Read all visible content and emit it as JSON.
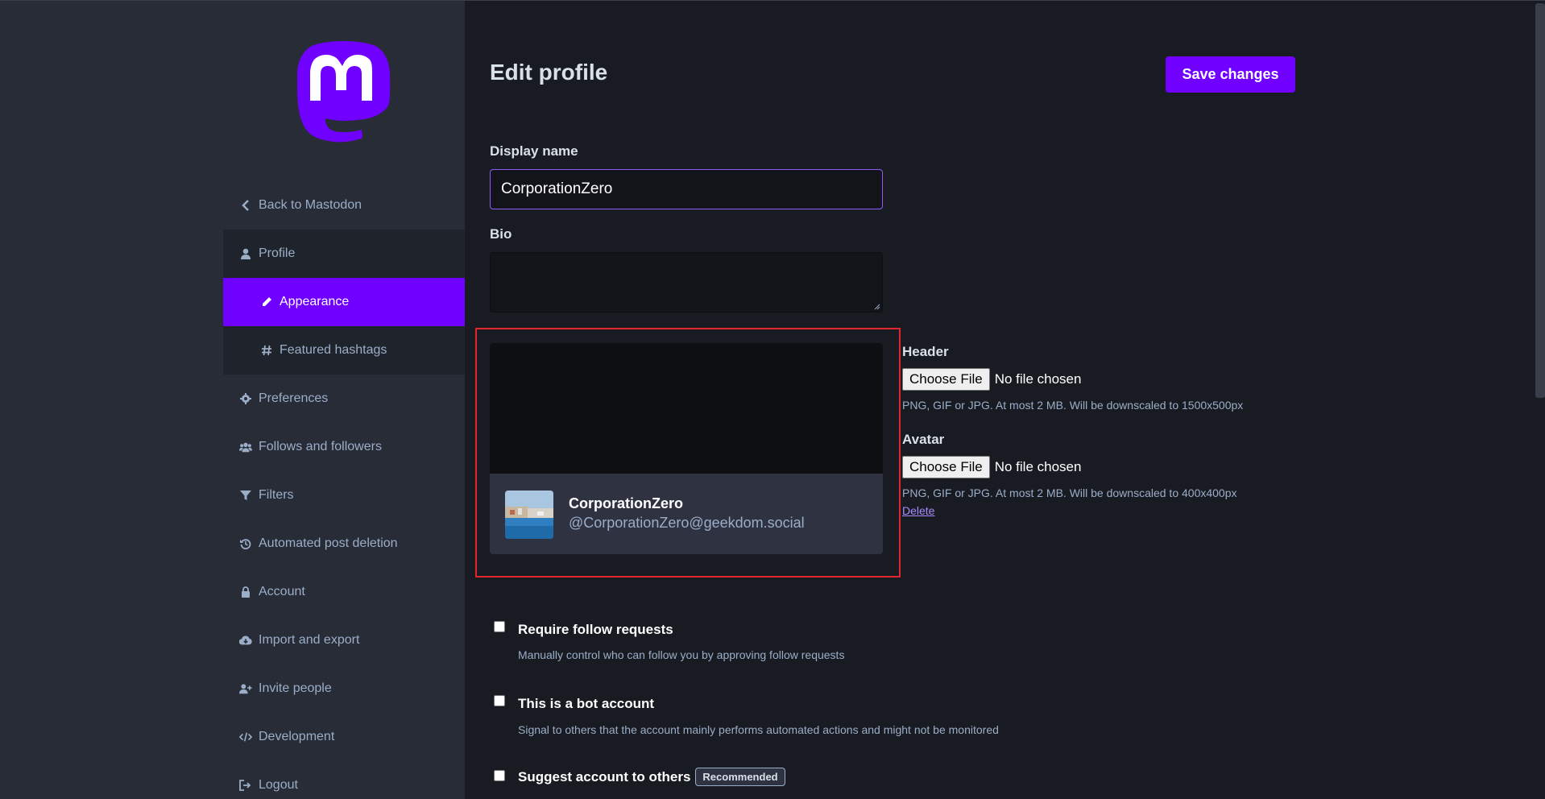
{
  "sidebar": {
    "items": [
      {
        "label": "Back to Mastodon",
        "icon": "chevron-left-icon"
      },
      {
        "label": "Profile",
        "icon": "user-icon"
      },
      {
        "label": "Appearance",
        "icon": "pencil-icon"
      },
      {
        "label": "Featured hashtags",
        "icon": "hashtag-icon"
      },
      {
        "label": "Preferences",
        "icon": "gear-icon"
      },
      {
        "label": "Follows and followers",
        "icon": "users-icon"
      },
      {
        "label": "Filters",
        "icon": "filter-icon"
      },
      {
        "label": "Automated post deletion",
        "icon": "history-icon"
      },
      {
        "label": "Account",
        "icon": "lock-icon"
      },
      {
        "label": "Import and export",
        "icon": "cloud-download-icon"
      },
      {
        "label": "Invite people",
        "icon": "user-plus-icon"
      },
      {
        "label": "Development",
        "icon": "code-icon"
      },
      {
        "label": "Logout",
        "icon": "sign-out-icon"
      }
    ]
  },
  "main": {
    "title": "Edit profile",
    "save_label": "Save changes",
    "display_name_label": "Display name",
    "display_name_value": "CorporationZero",
    "bio_label": "Bio",
    "bio_value": "",
    "preview": {
      "name": "CorporationZero",
      "handle": "@CorporationZero@geekdom.social"
    },
    "header_label": "Header",
    "header_button": "Choose File",
    "header_status": "No file chosen",
    "header_hint": "PNG, GIF or JPG. At most 2 MB. Will be downscaled to 1500x500px",
    "avatar_label": "Avatar",
    "avatar_button": "Choose File",
    "avatar_status": "No file chosen",
    "avatar_hint": "PNG, GIF or JPG. At most 2 MB. Will be downscaled to 400x400px",
    "avatar_delete": "Delete",
    "options": [
      {
        "label": "Require follow requests",
        "hint": "Manually control who can follow you by approving follow requests",
        "checked": false
      },
      {
        "label": "This is a bot account",
        "hint": "Signal to others that the account mainly performs automated actions and might not be monitored",
        "checked": false
      },
      {
        "label": "Suggest account to others",
        "badge": "Recommended",
        "checked": false
      }
    ]
  },
  "colors": {
    "accent": "#7000ff",
    "sidebar_bg": "#282c37",
    "content_bg": "#191b22",
    "muted_text": "#9baec8",
    "highlight_box": "#e0262b"
  }
}
